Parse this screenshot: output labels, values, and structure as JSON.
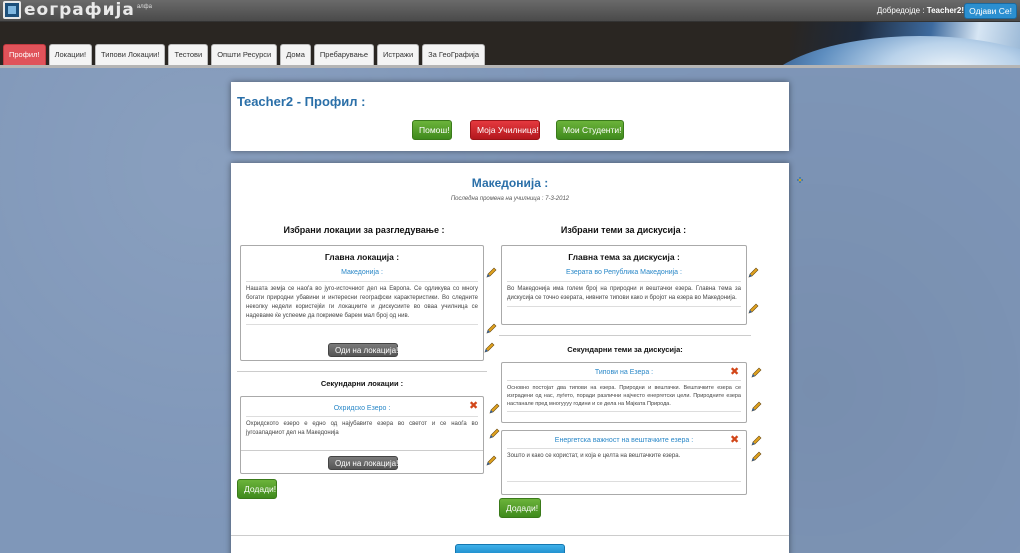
{
  "header": {
    "logo_text": "еографија",
    "logo_sub": "алфа",
    "welcome_prefix": "Добредојде :",
    "welcome_user": "Teacher2!",
    "logout_label": "Одјави Се!"
  },
  "tabs": [
    {
      "label": "Профил!"
    },
    {
      "label": "Локации!"
    },
    {
      "label": "Типови Локации!"
    },
    {
      "label": "Тестови"
    },
    {
      "label": "Општи Ресурси"
    },
    {
      "label": "Дома"
    },
    {
      "label": "Пребарување"
    },
    {
      "label": "Истражи"
    },
    {
      "label": "За ГеоГрафија"
    }
  ],
  "profile": {
    "title": "Teacher2 - Профил :",
    "help_label": "Помош!",
    "schools_label": "Моја Училница!",
    "students_label": "Мои Студенти!"
  },
  "classroom": {
    "name": "Македонија :",
    "last_change": "Последна промена на училница : 7-3-2012"
  },
  "locations": {
    "heading": "Избрани локации за разгледување :",
    "main_title": "Главна локација :",
    "main_sub": "Македонија :",
    "main_text": "Нашата земја се наоѓа во југо-источниот дел на Европа. Се одликува со многу богати природни убавини и интересни географски карактеристики. Во следните неколку недели користејќи ги локациите и дискусиите во оваа училница се надеваме ќе успееме да покриеме барем мал број од нив.",
    "go_label": "Оди на локација!",
    "secondary_heading": "Секундарни локации :",
    "sec_sub": "Охридско Езеро :",
    "sec_text": "Охридското езеро е едно од најубавите езера во светот и се наоѓа во југозападниот дел на Македонија",
    "sec_go_label": "Оди на локација!",
    "add_label": "Додади!"
  },
  "topics": {
    "heading": "Избрани теми за дискусија :",
    "main_title": "Главна тема за дискусија :",
    "main_sub": "Езерата во Република Македонија :",
    "main_text": "Во Македонија има голем број на природни и вештачки езера. Главна тема за дискусија се точно езерата, нивните типови како и бројот на езера во Македонија.",
    "secondary_heading": "Секундарни теми за дискусија:",
    "sec1_sub": "Типови на Езера :",
    "sec1_text": "Основно постојат два типови на езера. Природни и вештачки. Вештачките езера се изградени од нас, луѓето, поради различни најчесто енергетски цели. Природните езера настанале пред многуууу години и се дела на Мајката Природа.",
    "sec2_sub": "Енергетска важност на вештачките езера :",
    "sec2_text": "Зошто и како се користат, и која е целта на вештачките езера.",
    "add_label": "Додади!"
  }
}
